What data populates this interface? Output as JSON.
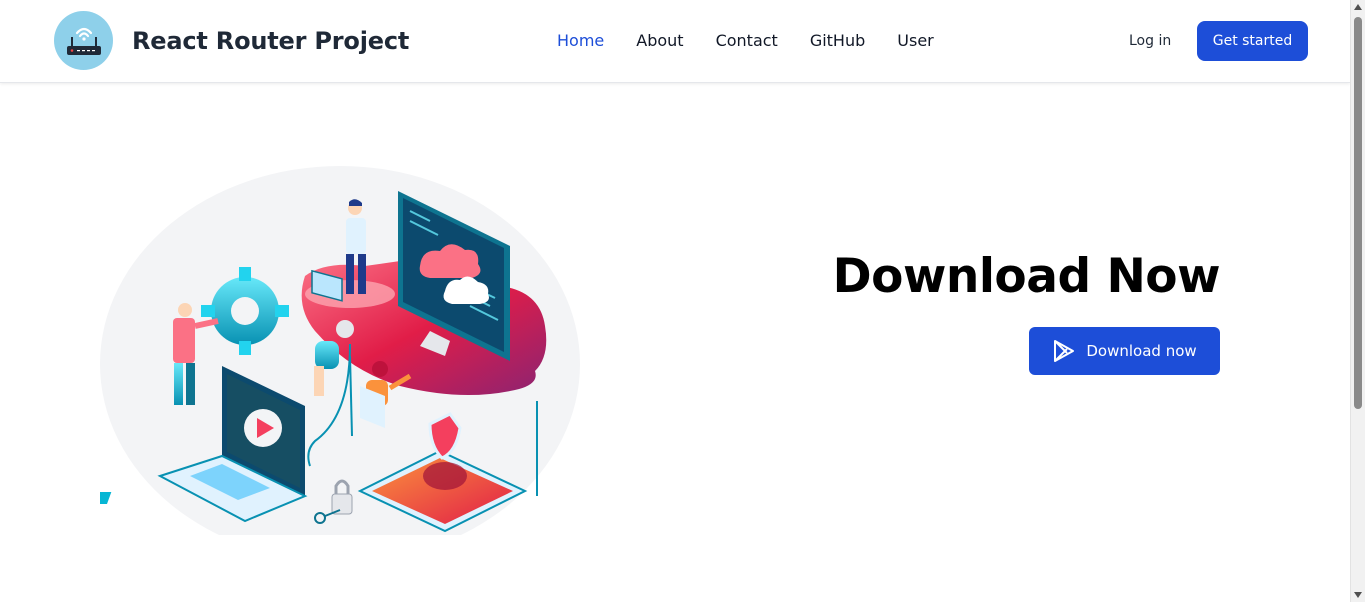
{
  "header": {
    "brand_title": "React Router Project",
    "logo_icon": "wifi-router-icon",
    "nav": [
      {
        "label": "Home",
        "active": true
      },
      {
        "label": "About",
        "active": false
      },
      {
        "label": "Contact",
        "active": false
      },
      {
        "label": "GitHub",
        "active": false
      },
      {
        "label": "User",
        "active": false
      }
    ],
    "login_label": "Log in",
    "cta_label": "Get started"
  },
  "hero": {
    "title": "Download Now",
    "download_button_label": "Download now",
    "download_icon": "play-store-icon",
    "illustration": "cloud-computing-isometric-illustration"
  },
  "colors": {
    "accent": "#1d4ed8",
    "logo_bg": "#8ed0ea",
    "cloud_gradient_start": "#fb7185",
    "cloud_gradient_end": "#9d2a7b"
  }
}
